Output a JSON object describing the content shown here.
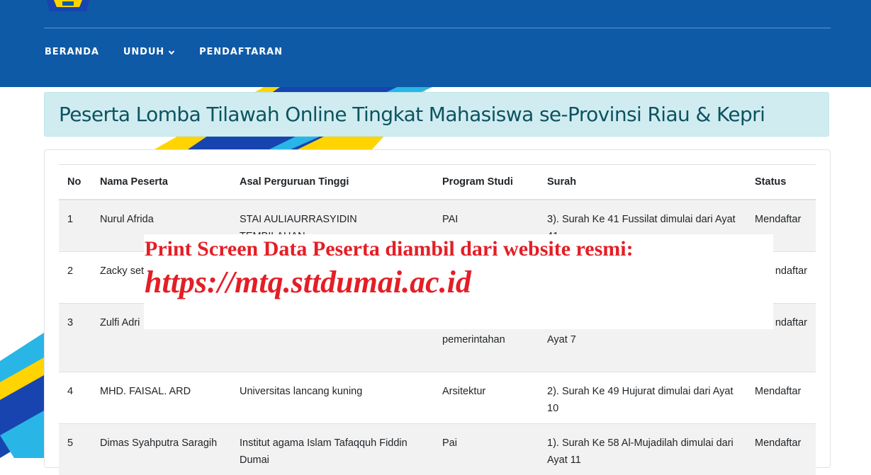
{
  "nav": {
    "items": [
      {
        "label": "BERANDA"
      },
      {
        "label": "UNDUH",
        "icon": "chevron-down-icon"
      },
      {
        "label": "PENDAFTARAN"
      }
    ]
  },
  "page": {
    "title": "Peserta Lomba Tilawah Online Tingkat Mahasiswa se-Provinsi Riau & Kepri"
  },
  "table": {
    "headers": [
      "No",
      "Nama Peserta",
      "Asal Perguruan Tinggi",
      "Program Studi",
      "Surah",
      "Status"
    ],
    "rows": [
      {
        "no": "1",
        "nama": "Nurul Afrida",
        "asal": "STAI AULIAURRASYIDIN TEMBILAHAN",
        "prodi": "PAI",
        "surah": "3). Surah Ke 41 Fussilat dimulai dari Ayat 41",
        "status": "Mendaftar"
      },
      {
        "no": "2",
        "nama": "Zacky set",
        "asal": "",
        "prodi": "",
        "surah": "",
        "status": "ndaftar"
      },
      {
        "no": "3",
        "nama": "Zulfi Adri",
        "asal": "",
        "prodi": "pemerintahan",
        "surah": "Ayat 7",
        "status": "ndaftar"
      },
      {
        "no": "4",
        "nama": "MHD. FAISAL. ARD",
        "asal": "Universitas lancang kuning",
        "prodi": "Arsitektur",
        "surah": "2). Surah Ke 49 Hujurat dimulai dari Ayat 10",
        "status": "Mendaftar"
      },
      {
        "no": "5",
        "nama": "Dimas Syahputra Saragih",
        "asal": "Institut agama Islam Tafaqquh Fiddin Dumai",
        "prodi": "Pai",
        "surah": "1). Surah Ke 58 Al-Mujadilah dimulai dari Ayat 11",
        "status": "Mendaftar"
      }
    ]
  },
  "overlay": {
    "line1": "Print Screen Data Peserta diambil dari website resmi:",
    "line2": "https://mtq.sttdumai.ac.id"
  },
  "colors": {
    "header_bg": "#0e5aa7",
    "alert_bg": "#d1ecf1",
    "alert_text": "#0c5460",
    "overlay_text": "#e41e26",
    "deco_yellow": "#ffd400",
    "deco_cyan": "#29b6e6",
    "deco_blue": "#1844b0"
  }
}
